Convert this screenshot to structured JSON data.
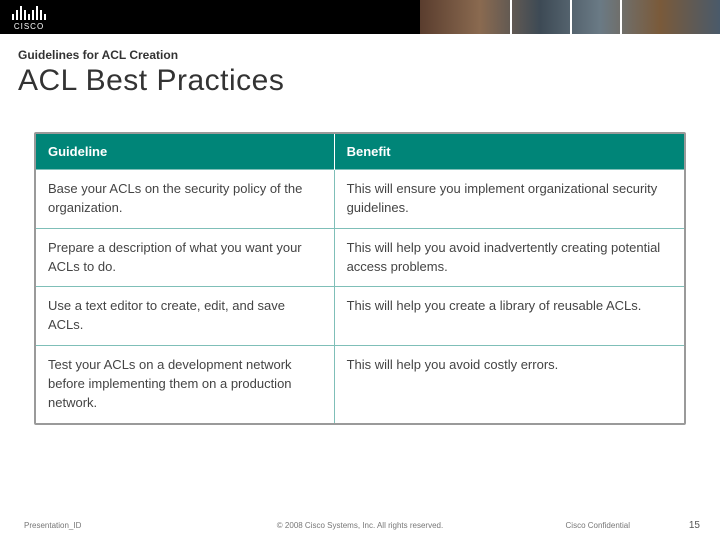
{
  "logo_text": "CISCO",
  "subtitle": "Guidelines for ACL Creation",
  "title": "ACL Best Practices",
  "table": {
    "headers": {
      "guideline": "Guideline",
      "benefit": "Benefit"
    },
    "rows": [
      {
        "g": "Base your ACLs on the security policy of the organization.",
        "b": "This will ensure you implement organizational security guidelines."
      },
      {
        "g": "Prepare a description of what you want your ACLs to do.",
        "b": "This will help you avoid inadvertently creating potential access problems."
      },
      {
        "g": "Use a text editor to create, edit, and save ACLs.",
        "b": "This will help you create a library of reusable ACLs."
      },
      {
        "g": "Test your ACLs on a development network before implementing them on a production network.",
        "b": "This will help you avoid costly errors."
      }
    ]
  },
  "footer": {
    "presentation_id": "Presentation_ID",
    "copyright": "© 2008 Cisco Systems, Inc. All rights reserved.",
    "confidential": "Cisco Confidential",
    "page": "15"
  }
}
